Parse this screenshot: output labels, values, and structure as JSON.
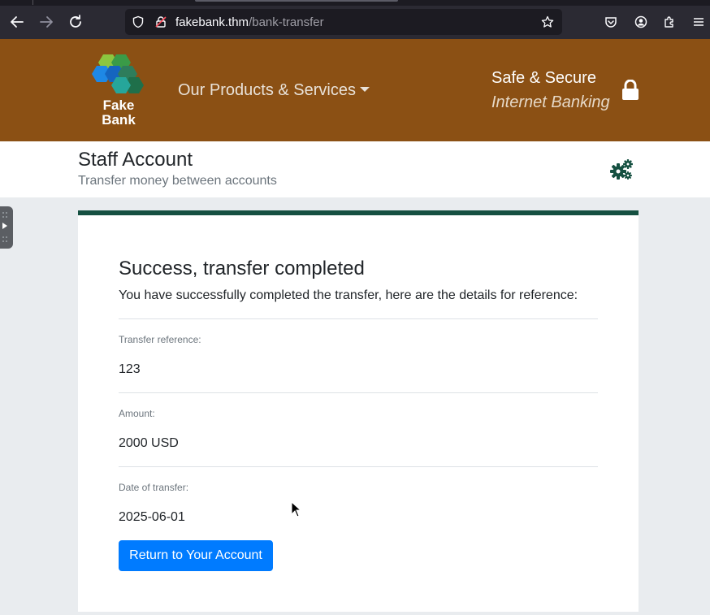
{
  "browser": {
    "url_host": "fakebank.thm",
    "url_path": "/bank-transfer"
  },
  "header": {
    "logo_line1": "Fake",
    "logo_line2": "Bank",
    "products_label": "Our Products & Services",
    "safe_label": "Safe & Secure",
    "banking_label": "Internet Banking"
  },
  "subheader": {
    "title": "Staff Account",
    "caption": "Transfer money between accounts"
  },
  "card": {
    "title": "Success, transfer completed",
    "lead": "You have successfully completed the transfer, here are the details for reference:",
    "fields": [
      {
        "label": "Transfer reference:",
        "value": "123"
      },
      {
        "label": "Amount:",
        "value": "2000 USD"
      },
      {
        "label": "Date of transfer:",
        "value": "2025-06-01"
      }
    ],
    "button_label": "Return to Your Account"
  },
  "colors": {
    "header_brown": "#8b5014",
    "card_accent": "#155041",
    "button_blue": "#007bff"
  },
  "icons": [
    "back-arrow-icon",
    "forward-arrow-icon",
    "reload-icon",
    "shield-icon",
    "insecure-lock-icon",
    "star-icon",
    "pocket-icon",
    "account-icon",
    "extensions-icon",
    "menu-icon",
    "lock-icon",
    "gears-icon"
  ]
}
